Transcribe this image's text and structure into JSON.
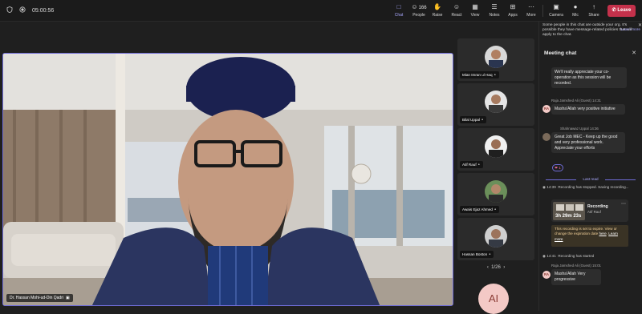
{
  "toolbar": {
    "timer": "05:00:56",
    "buttons": [
      {
        "key": "chat",
        "label": "Chat",
        "glyph": "□",
        "active": true
      },
      {
        "key": "people",
        "label": "People",
        "glyph": "☺",
        "count": "166"
      },
      {
        "key": "raise",
        "label": "Raise",
        "glyph": "✋"
      },
      {
        "key": "react",
        "label": "React",
        "glyph": "☺"
      },
      {
        "key": "view",
        "label": "View",
        "glyph": "▦"
      },
      {
        "key": "notes",
        "label": "Notes",
        "glyph": "☰"
      },
      {
        "key": "apps",
        "label": "Apps",
        "glyph": "⊞"
      },
      {
        "key": "more",
        "label": "More",
        "glyph": "⋯"
      },
      {
        "key": "camera",
        "label": "Camera",
        "glyph": "▣"
      },
      {
        "key": "mic",
        "label": "Mic",
        "glyph": "●"
      },
      {
        "key": "share",
        "label": "Share",
        "glyph": "↑"
      }
    ],
    "leave_label": "Leave"
  },
  "stage": {
    "speaker_name": "Dr. Hassan Mohi-ud-Din Qadri"
  },
  "gallery": {
    "participants": [
      {
        "name": "Mian Imran ul Haq"
      },
      {
        "name": "Bilal Uppal"
      },
      {
        "name": "Atif Rauf"
      },
      {
        "name": "Awais Ejaz Ahmed"
      },
      {
        "name": "Hassan Boston"
      }
    ],
    "pager": "1/26",
    "ai_initials": "AI"
  },
  "chat": {
    "banner": "Some people in this chat are outside your org. It's possible they have message-related policies that will apply to the chat.",
    "banner_link": "Learn more",
    "title": "Meeting chat",
    "messages": [
      {
        "text": "We'll really appreciate your co-operation as this session will be recorded."
      },
      {
        "author": "Raja Jamshed Ali (Guest)",
        "time": "14:31",
        "initials": "RA",
        "text": "Masha'Allah very positive initiative"
      },
      {
        "author": "Shahnawaz Uppal",
        "time": "14:36",
        "text": "Great Job MEC - Keep up the good and very professional work. Appreciate your efforts"
      },
      {
        "author": "Raja Jamshed Ali (Guest)",
        "time": "15:01",
        "initials": "RA",
        "text": "Masha'Allah Very progressive"
      }
    ],
    "reaction": "❤ 1",
    "last_read": "Last read",
    "system": {
      "stopped_time": "14:39",
      "stopped_text": "Recording has stopped. Saving recording...",
      "started_time": "14:41",
      "started_text": "Recording has started"
    },
    "recording": {
      "duration": "3h 29m 23s",
      "title": "Recording",
      "owner": "Atif Rauf"
    },
    "expire_text": "This recording is set to expire. View or change the expiration date",
    "expire_link1": "here",
    "expire_link2": "Learn more"
  },
  "colors": {
    "accent": "#6f6cd6",
    "leave": "#c4314b"
  }
}
